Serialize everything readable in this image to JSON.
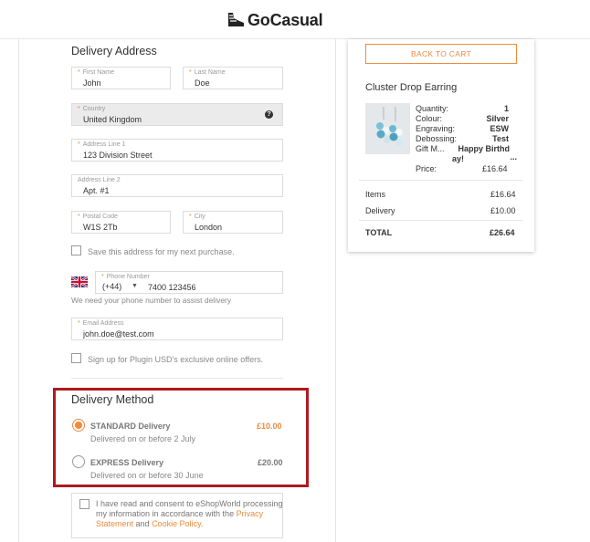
{
  "header": {
    "brand": "GoCasual",
    "logo_icon": "shoe-icon"
  },
  "delivery_address": {
    "title": "Delivery Address",
    "first_name": {
      "label": "First Name",
      "value": "John"
    },
    "last_name": {
      "label": "Last Name",
      "value": "Doe"
    },
    "country": {
      "label": "Country",
      "value": "United Kingdom",
      "help": "?"
    },
    "address_line_1": {
      "label": "Address Line 1",
      "value": "123 Division Street"
    },
    "address_line_2": {
      "label": "Address Line 2",
      "value": "Apt. #1"
    },
    "postal_code": {
      "label": "Postal Code",
      "value": "W1S 2Tb"
    },
    "city": {
      "label": "City",
      "value": "London"
    },
    "save_address": "Save this address for my next purchase.",
    "phone": {
      "label": "Phone Number",
      "code": "(+44)",
      "value": "7400 123456",
      "flag_icon": "uk-flag-icon",
      "note": "We need your phone number to assist delivery"
    },
    "email": {
      "label": "Email Address",
      "value": "john.doe@test.com"
    },
    "signup": "Sign up for Plugin USD's exclusive online offers."
  },
  "delivery_method": {
    "title": "Delivery Method",
    "options": [
      {
        "name": "STANDARD Delivery",
        "sub": "Delivered on or before 2 July",
        "price": "£10.00",
        "selected": true
      },
      {
        "name": "EXPRESS Delivery",
        "sub": "Delivered on or before 30 June",
        "price": "£20.00",
        "selected": false
      }
    ]
  },
  "consent": {
    "text_1": "I have read and consent to eShopWorld processing my information in accordance with the ",
    "privacy": "Privacy Statement",
    "and": " and ",
    "cookie": "Cookie Policy",
    "end": "."
  },
  "summary": {
    "back_button": "BACK TO CART",
    "product_title": "Cluster Drop Earring",
    "details": [
      {
        "key": "Quantity:",
        "value": "1"
      },
      {
        "key": "Colour:",
        "value": "Silver"
      },
      {
        "key": "Engraving:",
        "value": "ESW"
      },
      {
        "key": "Debossing:",
        "value": "Test"
      },
      {
        "key": "Gift M...",
        "value": "Happy Birthd"
      },
      {
        "key": "",
        "value": "ay!"
      },
      {
        "key": "Price:",
        "value": "£16.64"
      }
    ],
    "gift_ellipsis": "...",
    "items_label": "Items",
    "items_value": "£16.64",
    "delivery_label": "Delivery",
    "delivery_value": "£10.00",
    "total_label": "TOTAL",
    "total_value": "£26.64"
  },
  "colors": {
    "accent": "#f08a3c",
    "highlight": "#b01920"
  }
}
